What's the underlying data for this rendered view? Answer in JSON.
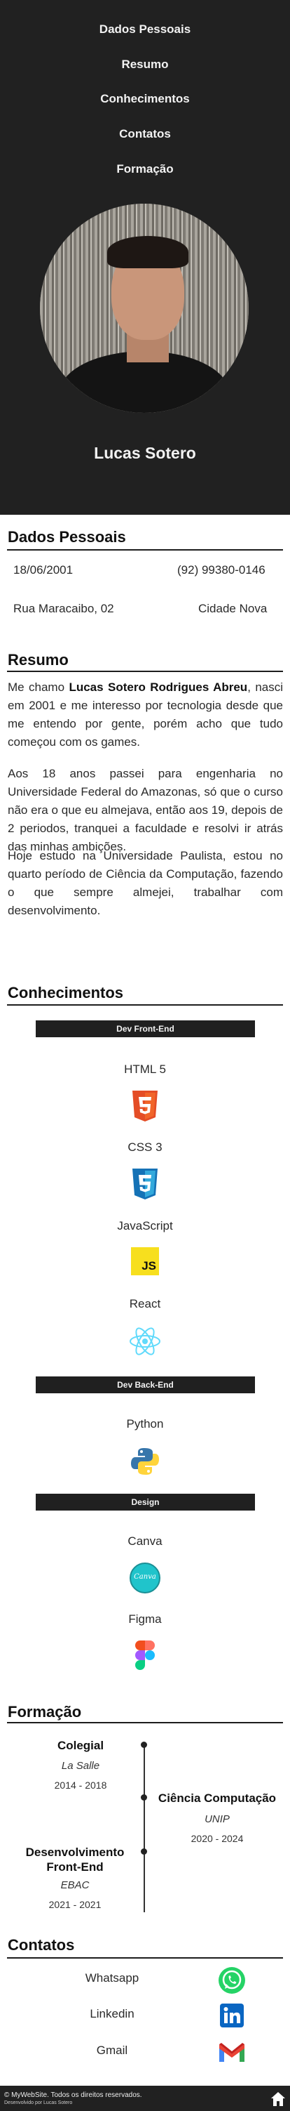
{
  "nav": {
    "items": [
      {
        "label": "Dados Pessoais"
      },
      {
        "label": "Resumo"
      },
      {
        "label": "Conhecimentos"
      },
      {
        "label": "Contatos"
      },
      {
        "label": "Formação"
      }
    ]
  },
  "profile": {
    "name": "Lucas Sotero"
  },
  "personal": {
    "title": "Dados Pessoais",
    "birth": "18/06/2001",
    "phone": "(92) 99380-0146",
    "address": "Rua Maracaibo, 02",
    "city": "Cidade Nova"
  },
  "resumo": {
    "title": "Resumo",
    "p1_pre": "Me chamo ",
    "p1_name": "Lucas Sotero Rodrigues Abreu",
    "p1_post": ", nasci em 2001 e me interesso por tecnologia desde que me entendo por gente, porém acho que tudo começou com os games.",
    "p2": "Aos 18 anos passei para engenharia no Universidade Federal do Amazonas, só que o curso não era o que eu almejava, então aos 19, depois de 2 periodos, tranquei a faculdade e resolvi ir atrás das minhas ambições.",
    "p3": "Hoje estudo na Universidade Paulista, estou no quarto período de Ciência da Computação, fazendo o que sempre almejei, trabalhar com desenvolvimento."
  },
  "conhecimentos": {
    "title": "Conhecimentos",
    "front": {
      "label": "Dev Front-End",
      "skills": [
        "HTML 5",
        "CSS 3",
        "JavaScript",
        "React"
      ]
    },
    "back": {
      "label": "Dev Back-End",
      "skills": [
        "Python"
      ]
    },
    "design": {
      "label": "Design",
      "skills": [
        "Canva",
        "Figma"
      ]
    },
    "icons": {
      "html": "html5-icon",
      "css": "css3-icon",
      "js": "javascript-icon",
      "react": "react-icon",
      "python": "python-icon",
      "canva": "canva-icon",
      "figma": "figma-icon",
      "js_label": "JS",
      "canva_label": "Canva"
    }
  },
  "formacao": {
    "title": "Formação",
    "items": [
      {
        "title": "Colegial",
        "school": "La Salle",
        "dates": "2014 - 2018"
      },
      {
        "title": "Ciência Computação",
        "school": "UNIP",
        "dates": "2020 - 2024"
      },
      {
        "title_line1": "Desenvolvimento",
        "title_line2": "Front-End",
        "school": "EBAC",
        "dates": "2021 - 2021"
      }
    ]
  },
  "contatos": {
    "title": "Contatos",
    "items": [
      {
        "label": "Whatsapp",
        "icon": "whatsapp-icon"
      },
      {
        "label": "Linkedin",
        "icon": "linkedin-icon"
      },
      {
        "label": "Gmail",
        "icon": "gmail-icon"
      }
    ]
  },
  "footer": {
    "copyright": "© MyWebSite. Todos os direitos reservados.",
    "credit": "Desenvolvido por Lucas Sotero"
  },
  "colors": {
    "dark": "#212121",
    "html": "#e44d26",
    "css": "#1572b6",
    "js": "#f7df1e",
    "react": "#61dafb",
    "whatsapp": "#25d366",
    "linkedin": "#0a66c2",
    "gmail": "#ea4335",
    "canva": "#20c4cb"
  }
}
